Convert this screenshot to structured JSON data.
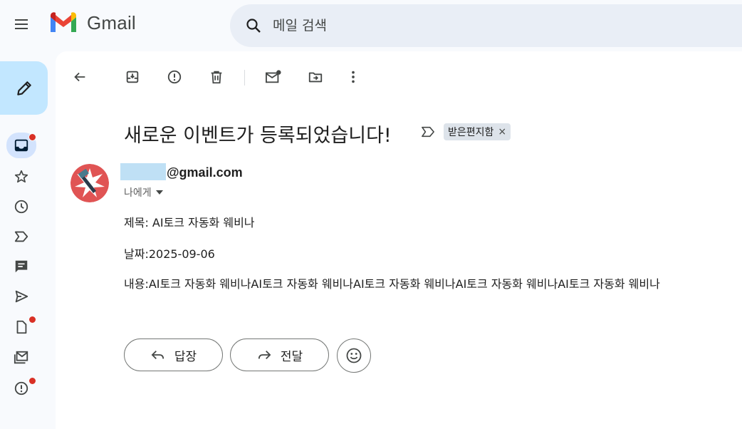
{
  "app": {
    "name": "Gmail"
  },
  "search": {
    "placeholder": "메일 검색"
  },
  "sidebar": {
    "items": [
      {
        "name": "inbox",
        "icon": "inbox-icon",
        "active": true,
        "badge": true
      },
      {
        "name": "starred",
        "icon": "star-icon"
      },
      {
        "name": "snoozed",
        "icon": "clock-icon"
      },
      {
        "name": "important",
        "icon": "label-important-icon"
      },
      {
        "name": "chat",
        "icon": "chat-icon"
      },
      {
        "name": "sent",
        "icon": "send-icon"
      },
      {
        "name": "drafts",
        "icon": "draft-icon",
        "badge": true
      },
      {
        "name": "all-mail",
        "icon": "all-mail-icon"
      },
      {
        "name": "spam",
        "icon": "spam-icon",
        "badge": true
      }
    ]
  },
  "toolbar": {
    "icons": [
      "back-icon",
      "archive-icon",
      "report-spam-icon",
      "delete-icon",
      "mark-unread-icon",
      "move-to-icon",
      "more-icon"
    ]
  },
  "email": {
    "subject": "새로운 이벤트가 등록되었습니다!",
    "label": "받은편지함",
    "label_close": "×",
    "sender": "@gmail.com",
    "recipient": "나에게",
    "body": {
      "line1": "제목: AI토크 자동화 웨비나",
      "line2": "날짜:2025-09-06",
      "line3": "내용:AI토크 자동화 웨비나AI토크 자동화 웨비나AI토크 자동화 웨비나AI토크 자동화 웨비나AI토크 자동화 웨비나"
    }
  },
  "actions": {
    "reply": "답장",
    "forward": "전달"
  },
  "colors": {
    "badge": "#d93025",
    "compose": "#c2e7ff",
    "search_bg": "#e9eef6",
    "active_nav": "#d3e3fd"
  }
}
